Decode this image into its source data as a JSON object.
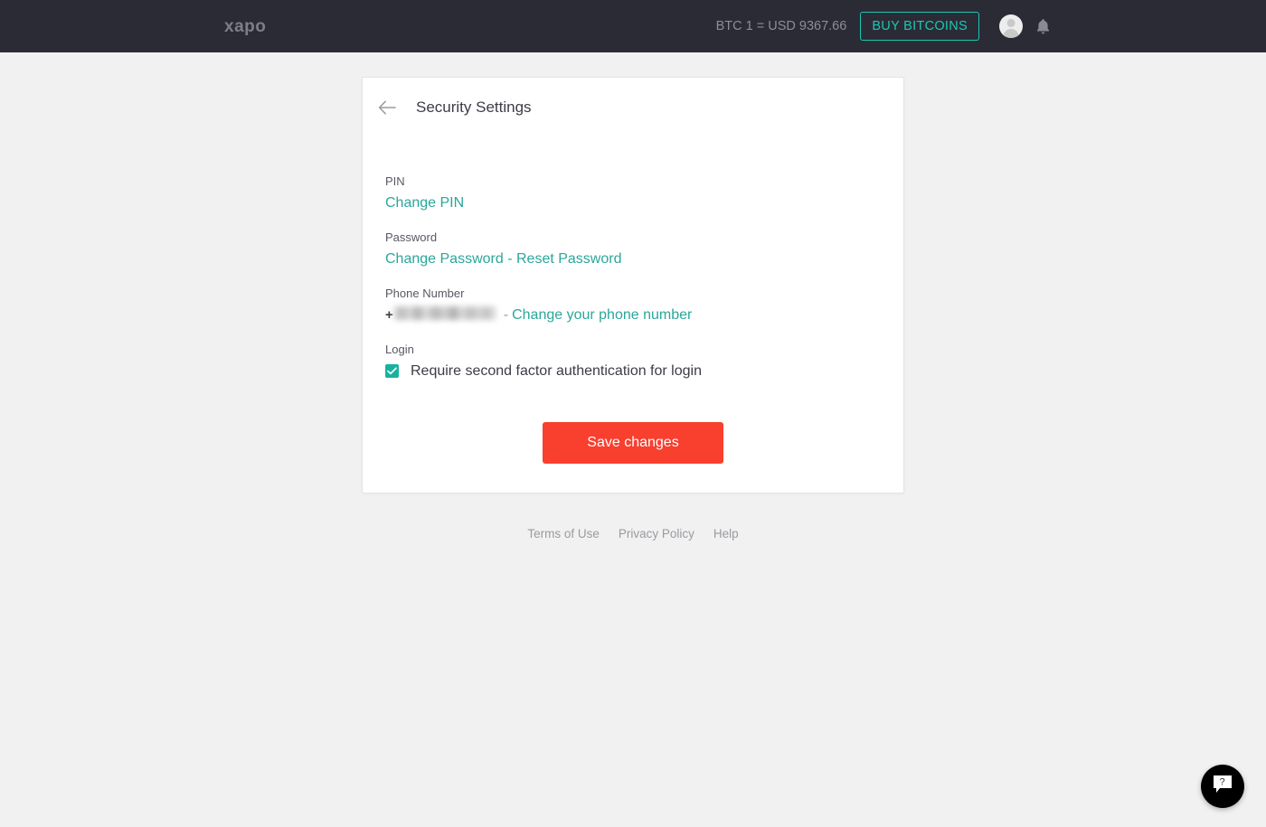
{
  "header": {
    "brand": "xapo",
    "btc_rate": "BTC 1 = USD 9367.66",
    "buy_button": "BUY BITCOINS",
    "avatar_icon": "user-avatar-icon",
    "bell_icon": "notification-bell-icon",
    "accent_teal": "#19c8b4",
    "background": "#2b2b36"
  },
  "card": {
    "back_icon": "back-arrow-icon",
    "title": "Security Settings",
    "sections": {
      "pin": {
        "label": "PIN",
        "change_link": "Change PIN"
      },
      "password": {
        "label": "Password",
        "change_link": "Change Password",
        "separator": "-",
        "reset_link": "Reset Password"
      },
      "phone": {
        "label": "Phone Number",
        "plus": "+",
        "number_redacted": "",
        "separator": "-",
        "change_link": "Change your phone number"
      },
      "login": {
        "label": "Login",
        "checkbox_checked": true,
        "checkbox_label": "Require second factor authentication for login",
        "checkbox_color": "#17b29f"
      }
    },
    "save_button": "Save changes",
    "save_button_color": "#f93f2e"
  },
  "footer": {
    "links": [
      {
        "label": "Terms of Use"
      },
      {
        "label": "Privacy Policy"
      },
      {
        "label": "Help"
      }
    ]
  },
  "chat_widget": {
    "icon": "help-chat-bubble-icon",
    "bubble_text": "?"
  }
}
